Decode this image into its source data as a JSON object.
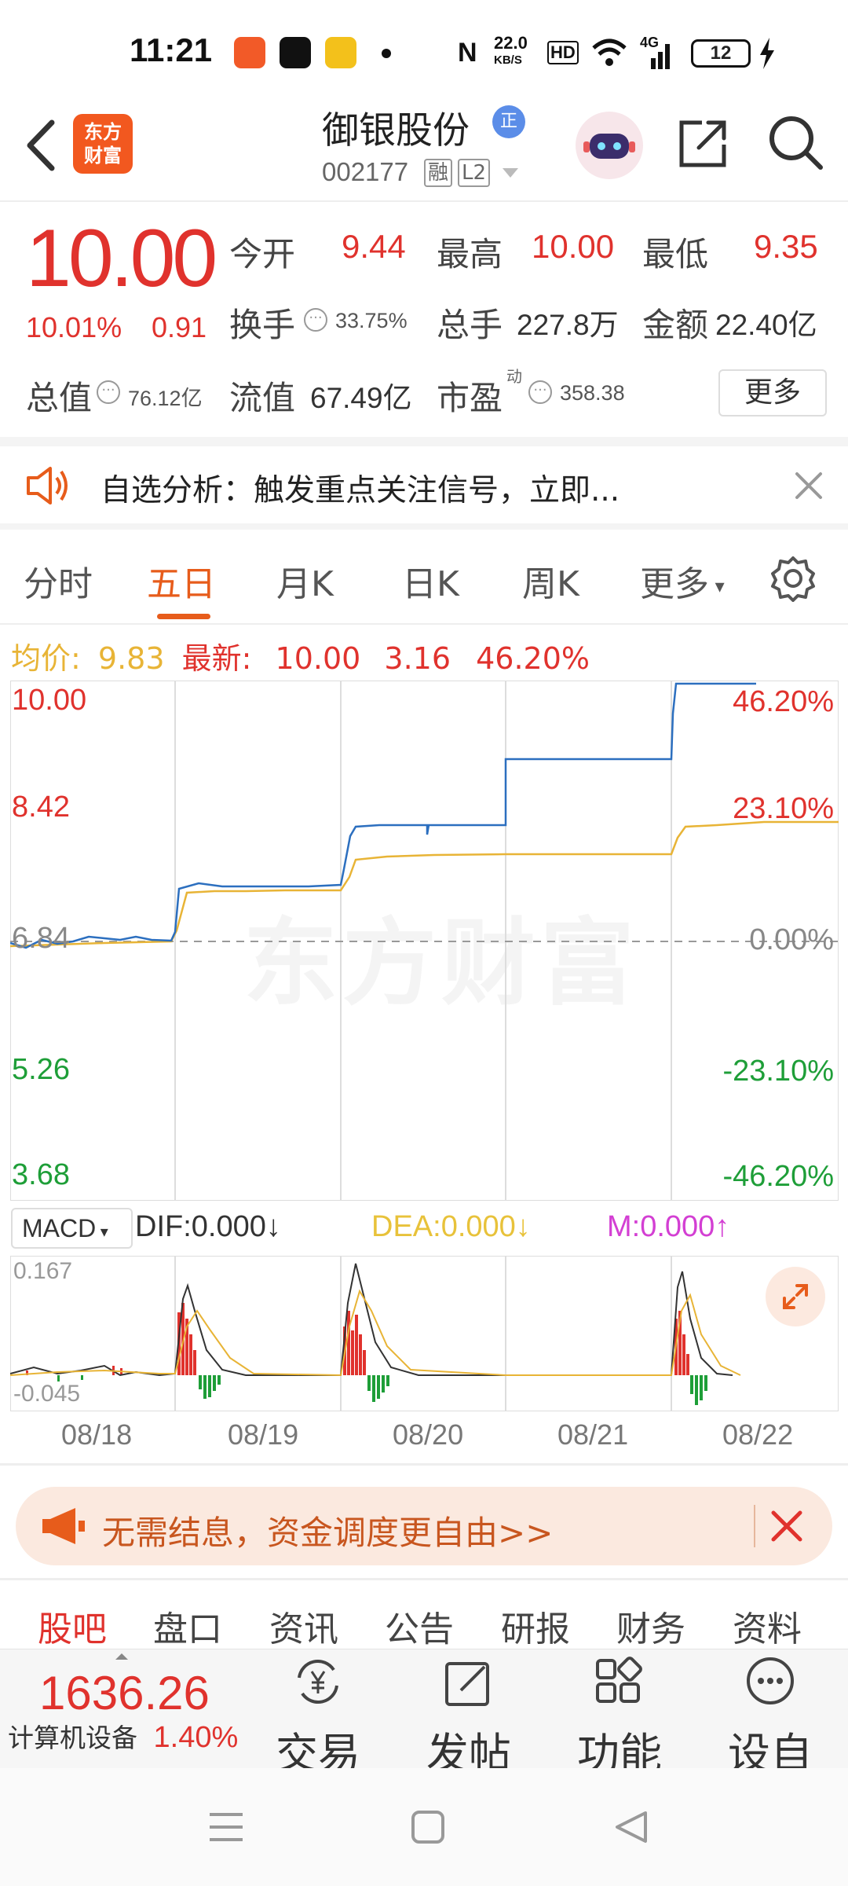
{
  "status_bar": {
    "time": "11:21",
    "net_speed_top": "22.0",
    "net_speed_unit": "KB/S",
    "hd": "HD",
    "network": "4G",
    "battery": "12"
  },
  "header": {
    "back_icon": "back-arrow-icon",
    "logo_line1": "东方",
    "logo_line2": "财富",
    "stock_name": "御银股份",
    "badge": "正",
    "code": "002177",
    "tag_margin": "融",
    "tag_level": "L2"
  },
  "quote": {
    "price": "10.00",
    "change_pct": "10.01%",
    "change": "0.91",
    "open_label": "今开",
    "open": "9.44",
    "high_label": "最高",
    "high": "10.00",
    "low_label": "最低",
    "low": "9.35",
    "turnover_label": "换手",
    "turnover": "33.75%",
    "volume_label": "总手",
    "volume": "227.8万",
    "amount_label": "金额",
    "amount": "22.40亿",
    "mktcap_label": "总值",
    "mktcap": "76.12亿",
    "float_label": "流值",
    "float": "67.49亿",
    "pe_label": "市盈",
    "pe_sup": "动",
    "pe": "358.38",
    "more": "更多"
  },
  "notice": {
    "text": "自选分析：触发重点关注信号，立即..."
  },
  "tabs": [
    "分时",
    "五日",
    "月K",
    "日K",
    "周K",
    "更多"
  ],
  "active_tab": "五日",
  "summary": {
    "avg_label": "均价:",
    "avg": "9.83",
    "latest_label": "最新:",
    "latest": "10.00",
    "chg": "3.16",
    "chg_pct": "46.20%"
  },
  "chart": {
    "watermark": "东方财富",
    "left_labels": [
      "10.00",
      "8.42",
      "6.84",
      "5.26",
      "3.68"
    ],
    "right_labels": [
      "46.20%",
      "23.10%",
      "0.00%",
      "-23.10%",
      "-46.20%"
    ],
    "colors": {
      "price": "#2c6fbf",
      "avg": "#e8b436",
      "up": "#e0322d",
      "down": "#1e9e38"
    }
  },
  "chart_data": {
    "type": "line",
    "x": [
      "08/18",
      "08/19",
      "08/20",
      "08/21",
      "08/22"
    ],
    "series": [],
    "ylim": [
      3.68,
      10.0
    ],
    "ylabel": "",
    "xlabel": ""
  },
  "macd": {
    "selector": "MACD",
    "dif": "DIF:0.000",
    "dea": "DEA:0.000",
    "m": "M:0.000",
    "top_label": "0.167",
    "bottom_label": "-0.045"
  },
  "dates": [
    "08/18",
    "08/19",
    "08/20",
    "08/21",
    "08/22"
  ],
  "banner": {
    "text": "无需结息，资金调度更自由>>"
  },
  "subtabs": [
    "股吧",
    "盘口",
    "资讯",
    "公告",
    "研报",
    "财务",
    "资料"
  ],
  "active_subtab": "股吧",
  "bottom": {
    "index_value": "1636.26",
    "index_name": "计算机设备",
    "index_pct": "1.40%",
    "nav": [
      {
        "label": "交易",
        "icon": "yen-exchange-icon"
      },
      {
        "label": "发帖",
        "icon": "edit-icon"
      },
      {
        "label": "功能",
        "icon": "grid-icon"
      },
      {
        "label": "设自",
        "icon": "more-dots-icon"
      }
    ]
  }
}
